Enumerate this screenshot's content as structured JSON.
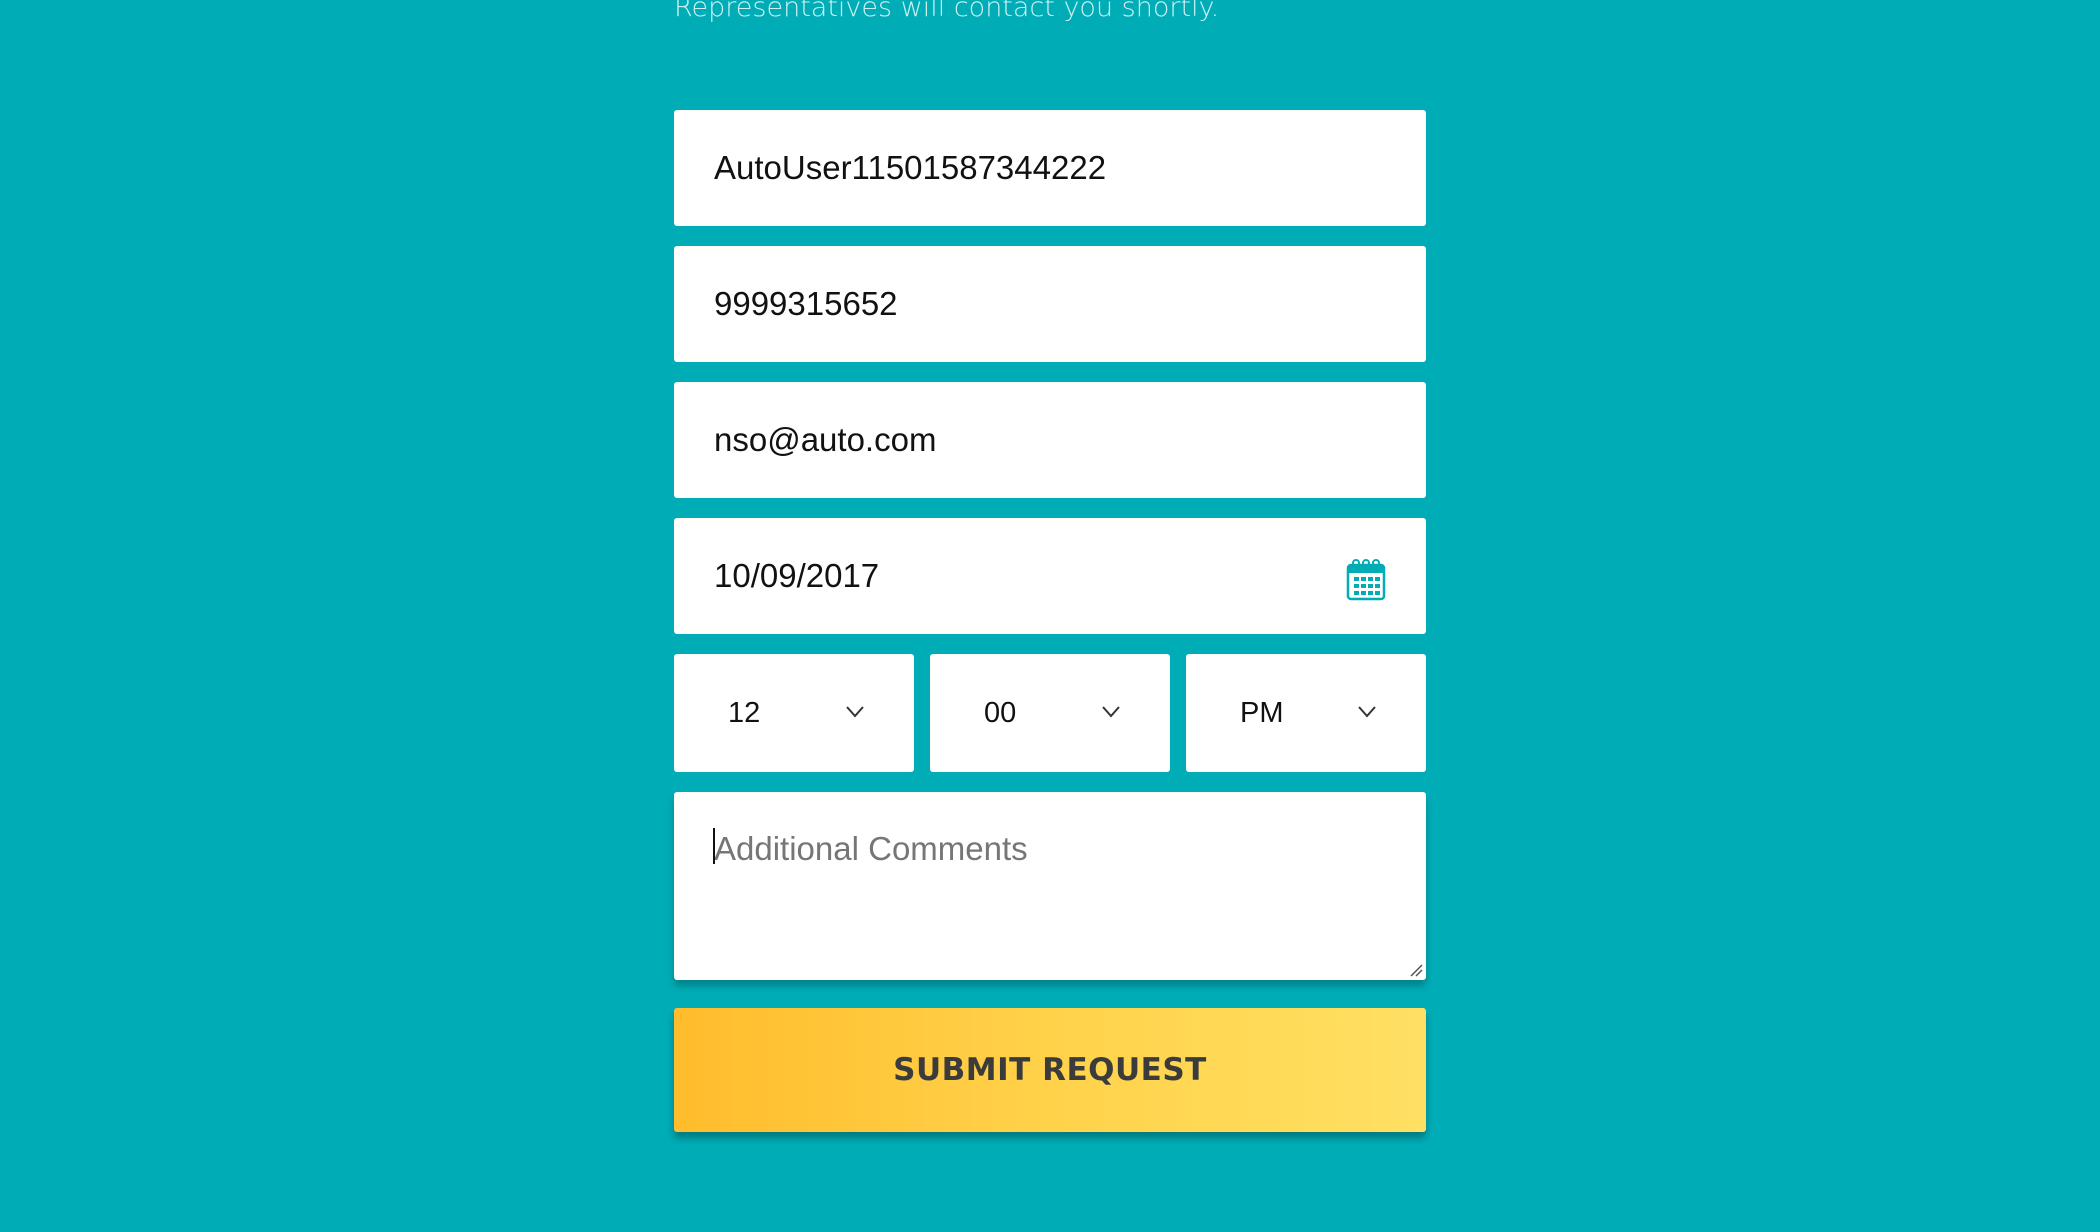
{
  "header": {
    "subtitle": "Representatives will contact you shortly."
  },
  "form": {
    "name_value": "AutoUser11501587344222",
    "phone_value": "9999315652",
    "email_value": "nso@auto.com",
    "date_value": "10/09/2017",
    "date_icon": "calendar-icon",
    "hour_selected": "12",
    "minute_selected": "00",
    "ampm_selected": "PM",
    "comments_placeholder": "Additional Comments",
    "submit_label": "SUBMIT REQUEST"
  },
  "colors": {
    "background": "#00adb7",
    "accent_icon": "#00adb7",
    "button_gradient_start": "#ffbc2c",
    "button_gradient_end": "#ffe063"
  }
}
